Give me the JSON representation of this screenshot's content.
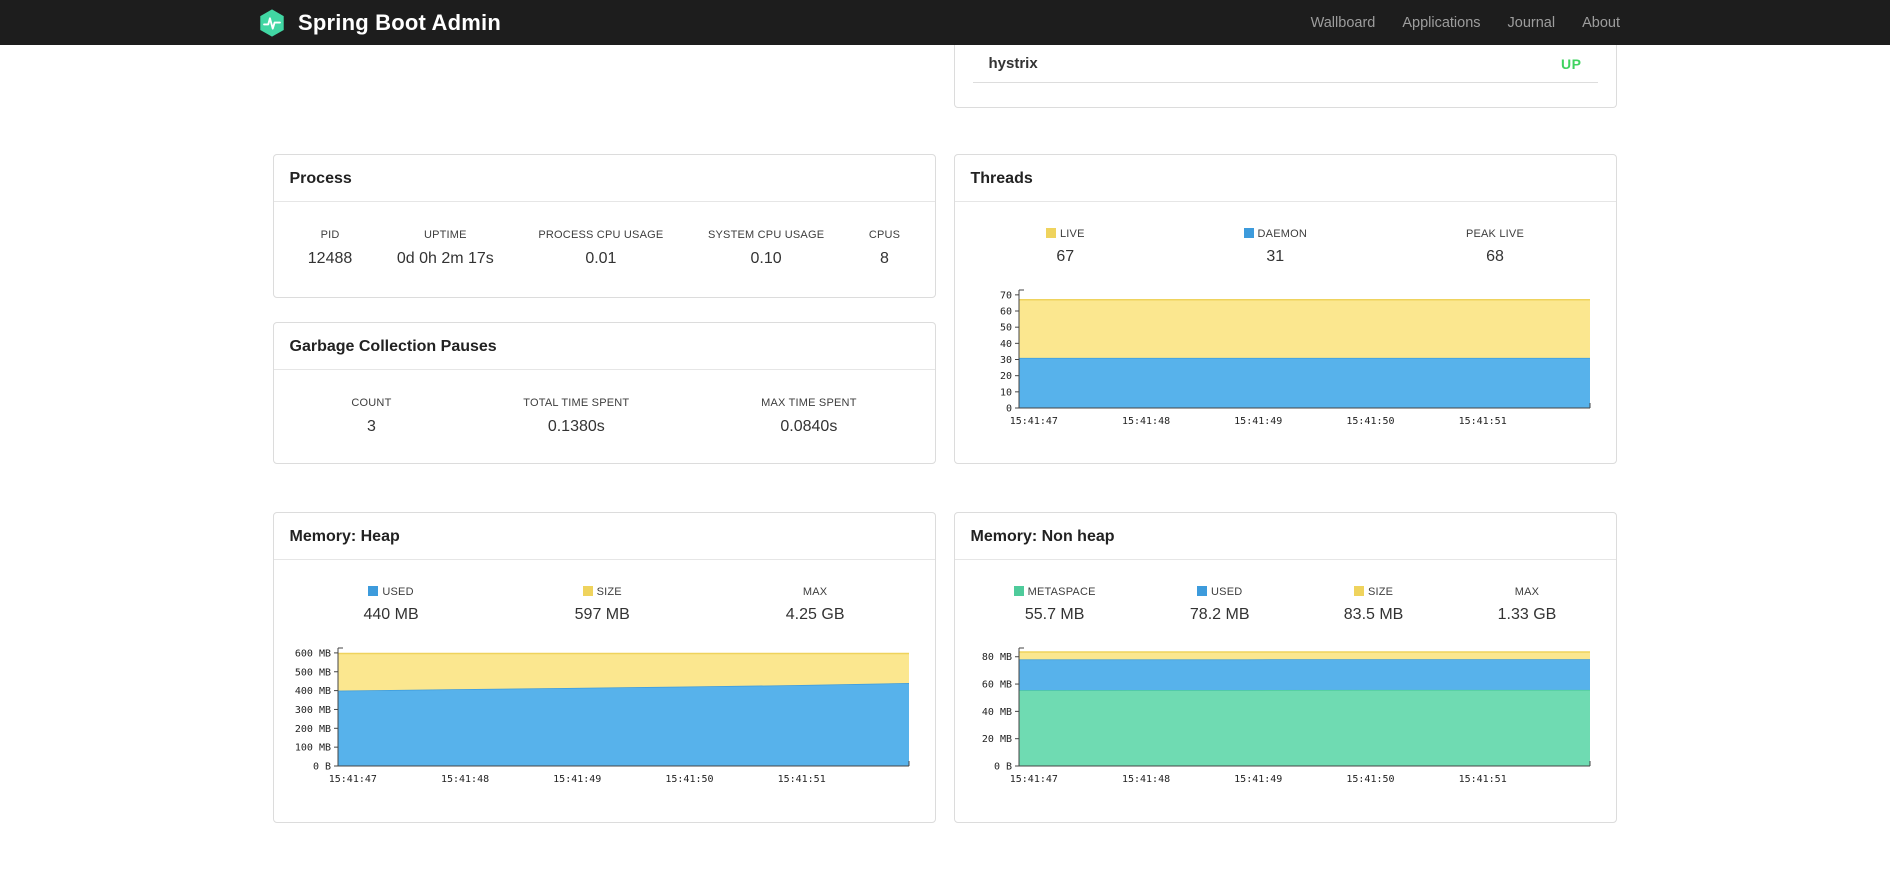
{
  "colors": {
    "up": "#3fd35f",
    "brand_accent": "#41d6a3",
    "navbar_bg": "#1d1d1d"
  },
  "navbar": {
    "brand": "Spring Boot Admin",
    "items": [
      {
        "label": "Wallboard"
      },
      {
        "label": "Applications"
      },
      {
        "label": "Journal"
      },
      {
        "label": "About"
      }
    ]
  },
  "health_panel": {
    "service": "hystrix",
    "status": "UP"
  },
  "process_panel": {
    "title": "Process",
    "metrics": [
      {
        "label": "PID",
        "value": "12488"
      },
      {
        "label": "UPTIME",
        "value": "0d 0h 2m 17s"
      },
      {
        "label": "PROCESS CPU USAGE",
        "value": "0.01"
      },
      {
        "label": "SYSTEM CPU USAGE",
        "value": "0.10"
      },
      {
        "label": "CPUS",
        "value": "8"
      }
    ]
  },
  "gc_panel": {
    "title": "Garbage Collection Pauses",
    "metrics": [
      {
        "label": "COUNT",
        "value": "3"
      },
      {
        "label": "TOTAL TIME SPENT",
        "value": "0.1380s"
      },
      {
        "label": "MAX TIME SPENT",
        "value": "0.0840s"
      }
    ]
  },
  "threads_panel": {
    "title": "Threads",
    "legend": [
      {
        "label": "LIVE",
        "value": "67",
        "color": "#efd35d"
      },
      {
        "label": "DAEMON",
        "value": "31",
        "color": "#3d9bdc"
      },
      {
        "label": "PEAK LIVE",
        "value": "68",
        "color": null
      }
    ]
  },
  "heap_panel": {
    "title": "Memory: Heap",
    "legend": [
      {
        "label": "USED",
        "value": "440 MB",
        "color": "#3d9bdc"
      },
      {
        "label": "SIZE",
        "value": "597 MB",
        "color": "#efd35d"
      },
      {
        "label": "MAX",
        "value": "4.25 GB",
        "color": null
      }
    ]
  },
  "nonheap_panel": {
    "title": "Memory: Non heap",
    "legend": [
      {
        "label": "METASPACE",
        "value": "55.7 MB",
        "color": "#4ecb9b"
      },
      {
        "label": "USED",
        "value": "78.2 MB",
        "color": "#3d9bdc"
      },
      {
        "label": "SIZE",
        "value": "83.5 MB",
        "color": "#efd35d"
      },
      {
        "label": "MAX",
        "value": "1.33 GB",
        "color": null
      }
    ]
  },
  "chart_data": [
    {
      "id": "threads-chart",
      "type": "area",
      "stacked": true,
      "title": "Threads",
      "x_labels": [
        "15:41:47",
        "15:41:48",
        "15:41:49",
        "15:41:50",
        "15:41:51"
      ],
      "y_ticks": [
        {
          "label": "0",
          "value": 0
        },
        {
          "label": "10",
          "value": 10
        },
        {
          "label": "20",
          "value": 20
        },
        {
          "label": "30",
          "value": 30
        },
        {
          "label": "40",
          "value": 40
        },
        {
          "label": "50",
          "value": 50
        },
        {
          "label": "60",
          "value": 60
        },
        {
          "label": "70",
          "value": 70
        }
      ],
      "ylim": [
        0,
        73
      ],
      "series": [
        {
          "name": "DAEMON",
          "fill": "#57b2eb",
          "stroke": "#3d9bdc",
          "values": [
            31,
            31,
            31,
            31,
            31,
            31
          ]
        },
        {
          "name": "LIVE",
          "fill": "#fbe78f",
          "stroke": "#efd35d",
          "values": [
            36,
            36,
            36,
            36,
            36,
            36
          ]
        }
      ]
    },
    {
      "id": "heap-chart",
      "type": "area",
      "stacked": true,
      "title": "Memory: Heap",
      "x_labels": [
        "15:41:47",
        "15:41:48",
        "15:41:49",
        "15:41:50",
        "15:41:51"
      ],
      "y_ticks": [
        {
          "label": "0 B",
          "value": 0
        },
        {
          "label": "100 MB",
          "value": 100
        },
        {
          "label": "200 MB",
          "value": 200
        },
        {
          "label": "300 MB",
          "value": 300
        },
        {
          "label": "400 MB",
          "value": 400
        },
        {
          "label": "500 MB",
          "value": 500
        },
        {
          "label": "600 MB",
          "value": 600
        }
      ],
      "ylim": [
        0,
        626
      ],
      "series": [
        {
          "name": "USED",
          "fill": "#57b2eb",
          "stroke": "#3d9bdc",
          "values": [
            400,
            407,
            414,
            421,
            429,
            440
          ]
        },
        {
          "name": "SIZE",
          "fill": "#fbe78f",
          "stroke": "#efd35d",
          "values": [
            197,
            190,
            183,
            176,
            168,
            157
          ]
        }
      ]
    },
    {
      "id": "nonheap-chart",
      "type": "area",
      "stacked": true,
      "title": "Memory: Non heap",
      "x_labels": [
        "15:41:47",
        "15:41:48",
        "15:41:49",
        "15:41:50",
        "15:41:51"
      ],
      "y_ticks": [
        {
          "label": "0 B",
          "value": 0
        },
        {
          "label": "20 MB",
          "value": 20
        },
        {
          "label": "40 MB",
          "value": 40
        },
        {
          "label": "60 MB",
          "value": 60
        },
        {
          "label": "80 MB",
          "value": 80
        }
      ],
      "ylim": [
        0,
        86.4
      ],
      "series": [
        {
          "name": "METASPACE",
          "fill": "#6fdbb2",
          "stroke": "#4ecb9b",
          "values": [
            55.5,
            55.6,
            55.6,
            55.7,
            55.7,
            55.7
          ]
        },
        {
          "name": "USED",
          "fill": "#57b2eb",
          "stroke": "#3d9bdc",
          "values": [
            22.6,
            22.5,
            22.5,
            22.5,
            22.5,
            22.5
          ]
        },
        {
          "name": "SIZE",
          "fill": "#fbe78f",
          "stroke": "#efd35d",
          "values": [
            5.4,
            5.4,
            5.4,
            5.3,
            5.3,
            5.3
          ]
        }
      ]
    }
  ]
}
